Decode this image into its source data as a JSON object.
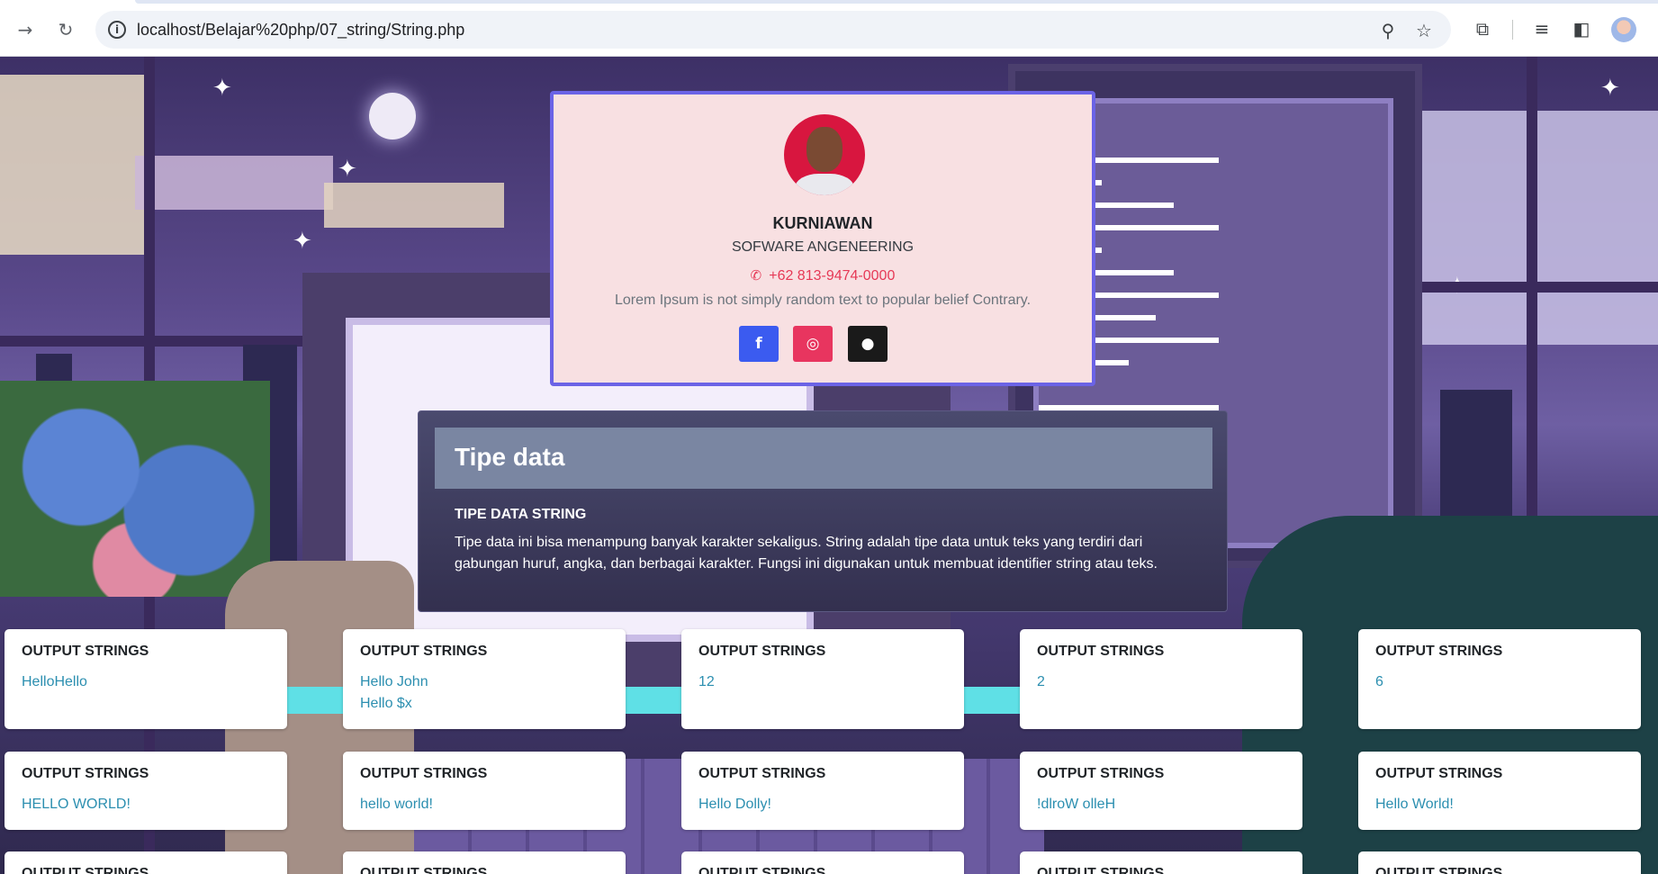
{
  "browser": {
    "url": "localhost/Belajar%20php/07_string/String.php",
    "icons": [
      "forward-icon",
      "reload-icon",
      "site-info-icon",
      "zoom-icon",
      "bookmark-star-icon",
      "extensions-icon",
      "media-icon",
      "side-panel-icon",
      "profile-avatar"
    ]
  },
  "profile": {
    "name": "KURNIAWAN",
    "role": "SOFWARE ANGENEERING",
    "phone": "+62 813-9474-0000",
    "description": "Lorem Ipsum is not simply random text to popular belief Contrary.",
    "social": {
      "facebook": "f",
      "instagram": "◎",
      "github": "●"
    }
  },
  "tipe_data": {
    "title": "Tipe data",
    "subtitle": "TIPE DATA STRING",
    "text": "Tipe data ini bisa menampung banyak karakter sekaligus. String adalah tipe data untuk teks yang terdiri dari gabungan huruf, angka, dan berbagai karakter. Fungsi ini digunakan untuk membuat identifier string atau teks."
  },
  "outputs": {
    "heading": "OUTPUT STRINGS",
    "row1": [
      "HelloHello",
      "Hello John\nHello $x",
      "12",
      "2",
      "6"
    ],
    "row2": [
      "HELLO WORLD!",
      "hello world!",
      "Hello Dolly!",
      "!dlroW olleH",
      "Hello World!"
    ]
  },
  "colors": {
    "accent_border": "#6b63e6",
    "card_pink": "#f8e0e2",
    "phone_red": "#e63956",
    "output_value": "#2c8fb0",
    "facebook": "#3b5bf0",
    "instagram": "#e8355f",
    "github": "#1a1a1a"
  }
}
